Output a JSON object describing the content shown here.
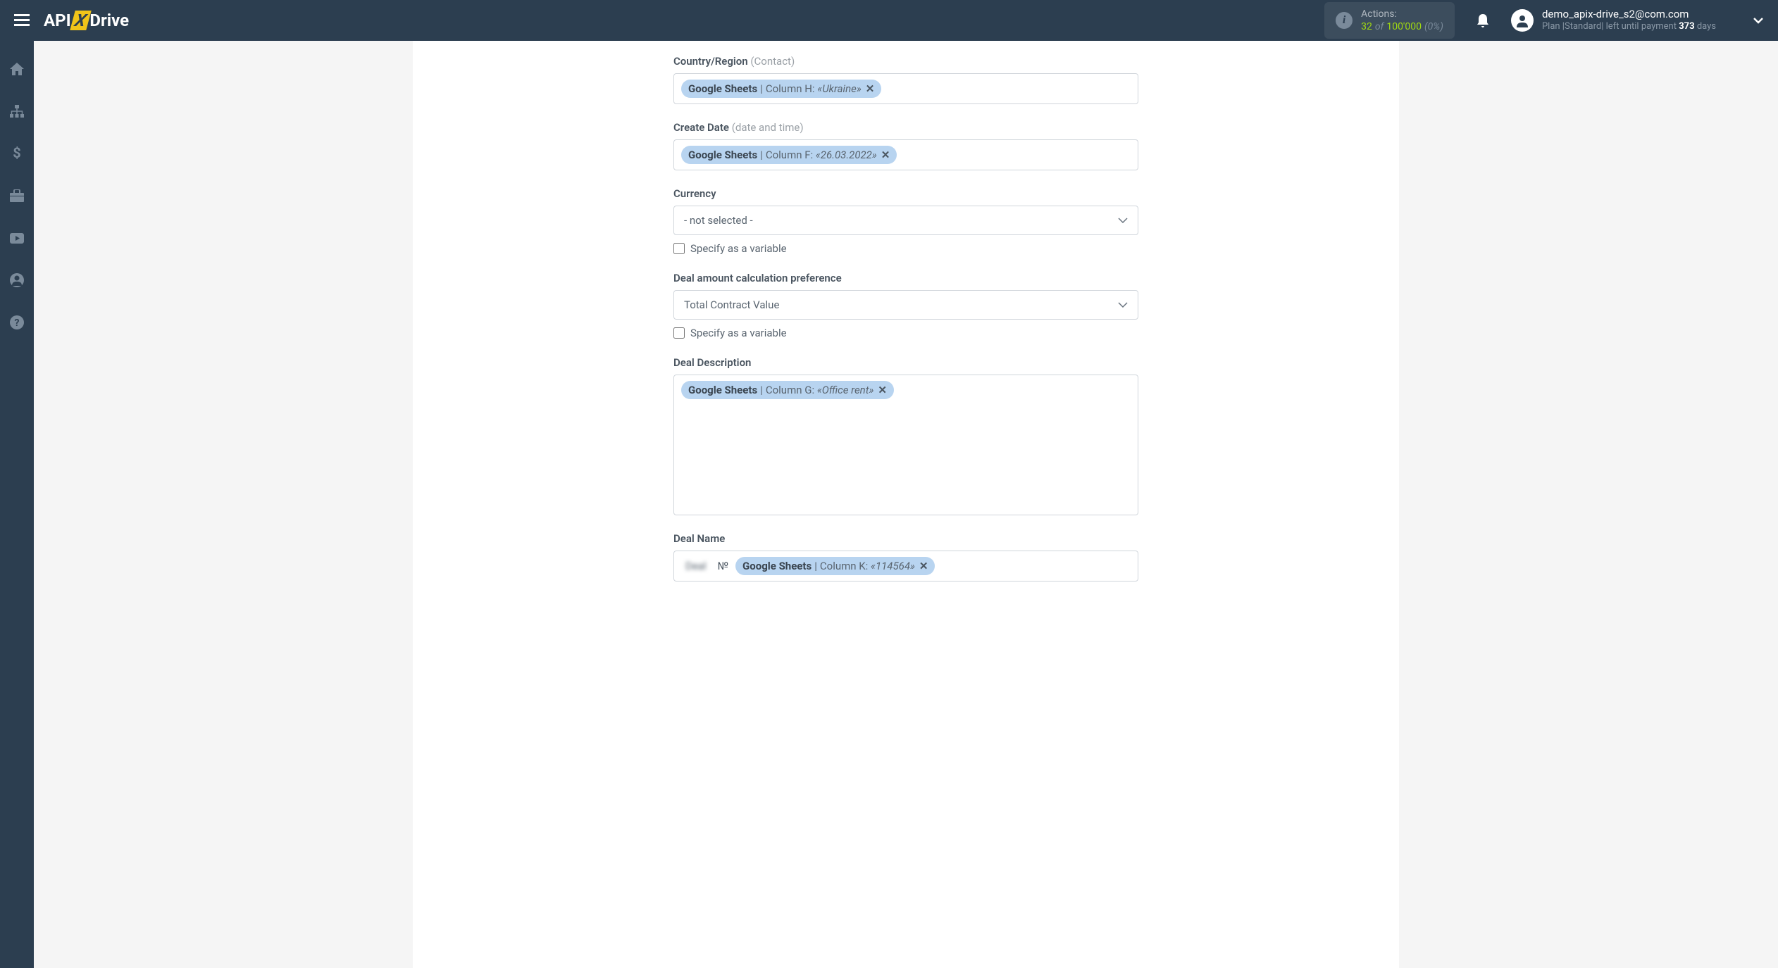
{
  "header": {
    "logo": {
      "api": "API",
      "x": "X",
      "drive": "Drive"
    },
    "actions": {
      "label": "Actions:",
      "current": "32",
      "of": "of",
      "max": "100'000",
      "pct": "(0%)"
    },
    "user": {
      "email": "demo_apix-drive_s2@com.com",
      "plan_prefix": "Plan |",
      "plan_name": "Standard",
      "plan_sep": "| left until payment ",
      "plan_days": "373",
      "plan_suffix": " days"
    }
  },
  "fields": {
    "country": {
      "label": "Country/Region",
      "hint": "(Contact)",
      "token": {
        "source": "Google Sheets",
        "column": "Column H:",
        "value": "«Ukraine»"
      }
    },
    "createDate": {
      "label": "Create Date",
      "hint": "(date and time)",
      "token": {
        "source": "Google Sheets",
        "column": "Column F:",
        "value": "«26.03.2022»"
      }
    },
    "currency": {
      "label": "Currency",
      "selected": "- not selected -",
      "checkbox": "Specify as a variable"
    },
    "dealAmount": {
      "label": "Deal amount calculation preference",
      "selected": "Total Contract Value",
      "checkbox": "Specify as a variable"
    },
    "dealDescription": {
      "label": "Deal Description",
      "token": {
        "source": "Google Sheets",
        "column": "Column G:",
        "value": "«Office rent»"
      }
    },
    "dealName": {
      "label": "Deal Name",
      "prefix_blur": "Deal",
      "prefix_clear": "№",
      "token": {
        "source": "Google Sheets",
        "column": "Column K:",
        "value": "«114564»"
      }
    }
  }
}
